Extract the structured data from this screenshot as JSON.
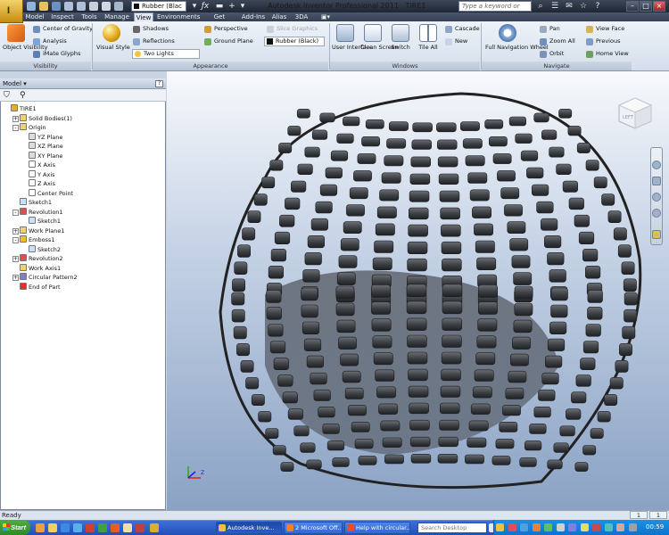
{
  "app_menu_label": "I",
  "window": {
    "title": "Autodesk Inventor Professional 2011",
    "document": "TIRE1"
  },
  "quick_access": {
    "material_value": "Rubber (Blac",
    "search_placeholder": "Type a keyword or phrase"
  },
  "tabs": [
    "Model",
    "Inspect",
    "Tools",
    "Manage",
    "View",
    "Environments",
    "Get Started",
    "Add-Ins",
    "Alias",
    "3DA"
  ],
  "active_tab": "View",
  "ribbon": {
    "visibility": {
      "label": "Visibility",
      "object_visibility": "Object Visibility",
      "center_of_gravity": "Center of Gravity",
      "analysis": "Analysis",
      "imate_glyphs": "iMate Glyphs"
    },
    "appearance": {
      "label": "Appearance",
      "visual_style": "Visual Style",
      "shadows": "Shadows",
      "reflections": "Reflections",
      "lighting": "Two Lights",
      "perspective": "Perspective",
      "ground_plane": "Ground Plane",
      "slice_graphics": "Slice Graphics",
      "material": "Rubber (Black)"
    },
    "windows": {
      "label": "Windows",
      "user_interface": "User Interface",
      "clean_screen": "Clean Screen",
      "switch": "Switch",
      "tile_all": "Tile All",
      "cascade": "Cascade",
      "new": "New"
    },
    "navigate": {
      "label": "Navigate",
      "full_navigation_wheel": "Full Navigation Wheel",
      "pan": "Pan",
      "zoom_all": "Zoom All",
      "orbit": "Orbit",
      "view_face": "View Face",
      "previous": "Previous",
      "home_view": "Home View"
    }
  },
  "browser": {
    "title": "Model",
    "help": "?",
    "tree": [
      {
        "label": "TIRE1",
        "level": 0,
        "icon": "part-icon",
        "color": "#e8b020",
        "expand": ""
      },
      {
        "label": "Solid Bodies(1)",
        "level": 1,
        "icon": "folder-icon",
        "color": "#f0d070",
        "expand": "+"
      },
      {
        "label": "Origin",
        "level": 1,
        "icon": "folder-icon",
        "color": "#f0d070",
        "expand": "-"
      },
      {
        "label": "YZ Plane",
        "level": 2,
        "icon": "plane-icon",
        "color": "#dcdcdc",
        "expand": ""
      },
      {
        "label": "XZ Plane",
        "level": 2,
        "icon": "plane-icon",
        "color": "#dcdcdc",
        "expand": ""
      },
      {
        "label": "XY Plane",
        "level": 2,
        "icon": "plane-icon",
        "color": "#dcdcdc",
        "expand": ""
      },
      {
        "label": "X Axis",
        "level": 2,
        "icon": "axis-icon",
        "color": "#ffffff",
        "expand": ""
      },
      {
        "label": "Y Axis",
        "level": 2,
        "icon": "axis-icon",
        "color": "#ffffff",
        "expand": ""
      },
      {
        "label": "Z Axis",
        "level": 2,
        "icon": "axis-icon",
        "color": "#ffffff",
        "expand": ""
      },
      {
        "label": "Center Point",
        "level": 2,
        "icon": "point-icon",
        "color": "#ffffff",
        "expand": ""
      },
      {
        "label": "Sketch1",
        "level": 1,
        "icon": "sketch-icon",
        "color": "#c8e0f8",
        "expand": ""
      },
      {
        "label": "Revolution1",
        "level": 1,
        "icon": "revolve-icon",
        "color": "#e05050",
        "expand": "-"
      },
      {
        "label": "Sketch1",
        "level": 2,
        "icon": "sketch-icon",
        "color": "#c8e0f8",
        "expand": ""
      },
      {
        "label": "Work Plane1",
        "level": 1,
        "icon": "workplane-icon",
        "color": "#f0d070",
        "expand": "+"
      },
      {
        "label": "Emboss1",
        "level": 1,
        "icon": "emboss-icon",
        "color": "#f0c030",
        "expand": "-"
      },
      {
        "label": "Sketch2",
        "level": 2,
        "icon": "sketch-icon",
        "color": "#c8e0f8",
        "expand": ""
      },
      {
        "label": "Revolution2",
        "level": 1,
        "icon": "revolve-icon",
        "color": "#e05050",
        "expand": "+"
      },
      {
        "label": "Work Axis1",
        "level": 1,
        "icon": "workaxis-icon",
        "color": "#f0d070",
        "expand": ""
      },
      {
        "label": "Circular Pattern2",
        "level": 1,
        "icon": "pattern-icon",
        "color": "#8080c0",
        "expand": "+"
      },
      {
        "label": "End of Part",
        "level": 1,
        "icon": "end-of-part-icon",
        "color": "#e03030",
        "expand": ""
      }
    ]
  },
  "viewcube_face": "LEFT",
  "status": {
    "text": "Ready",
    "cell1": "1",
    "cell2": "1"
  },
  "taskbar": {
    "start": "Start",
    "tasks": [
      "Autodesk Inve...",
      "2 Microsoft Off...",
      "Help with circular..."
    ],
    "search_placeholder": "Search Desktop",
    "clock": "00:59"
  }
}
